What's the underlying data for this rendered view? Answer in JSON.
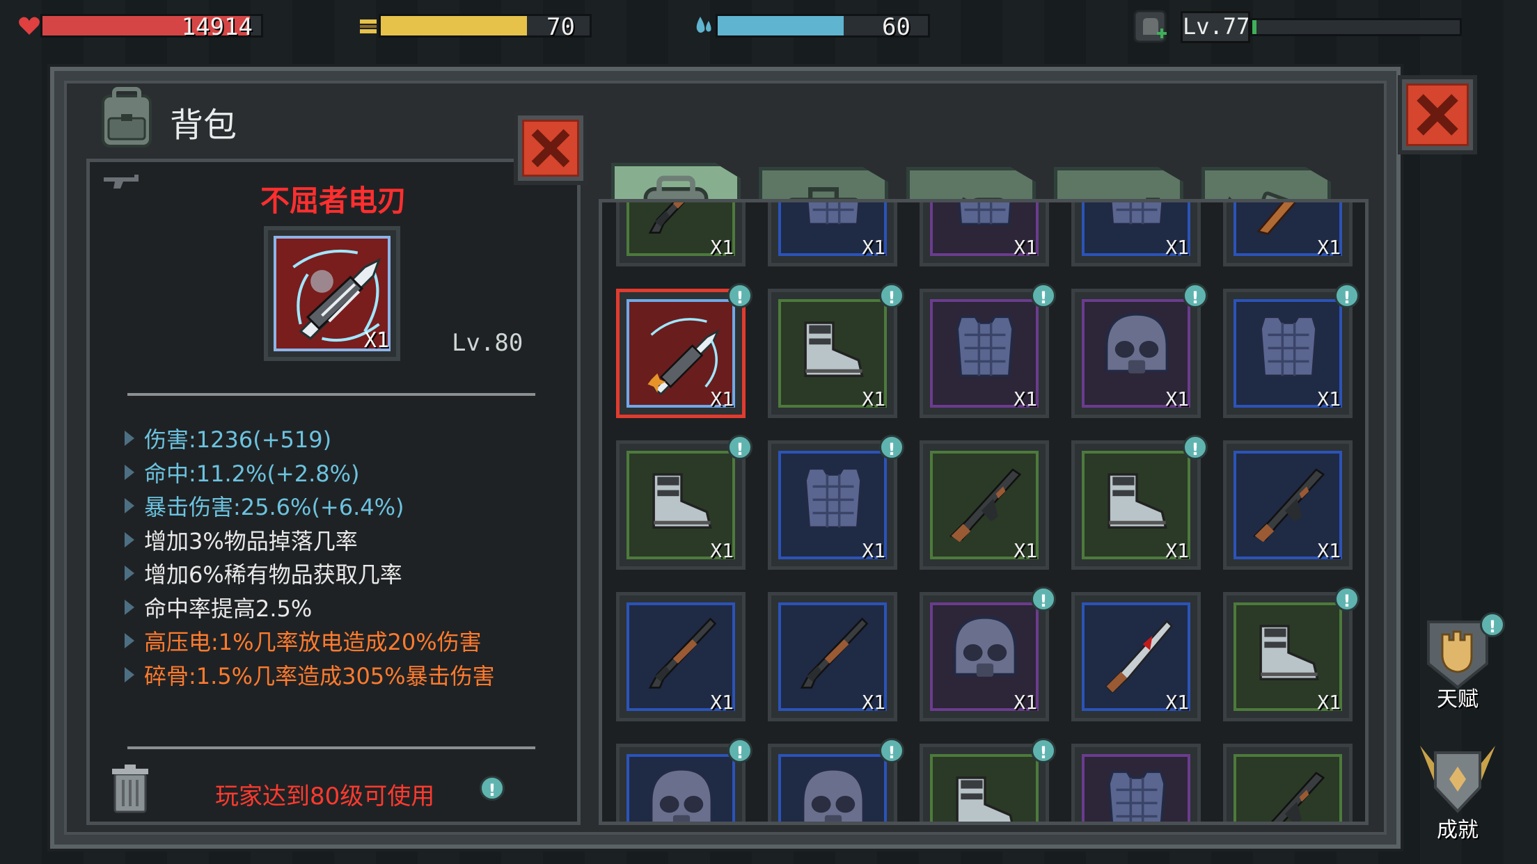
{
  "hud": {
    "hp": {
      "value": "14914",
      "fill": 0.95,
      "color": "#d64545"
    },
    "food": {
      "value": "70",
      "fill": 0.7,
      "color": "#e6c24a"
    },
    "water": {
      "value": "60",
      "fill": 0.6,
      "color": "#5fb4cf"
    },
    "level": {
      "label": "Lv.77",
      "fill": 0.02,
      "color": "#3fb05a"
    }
  },
  "panel": {
    "title": "背包",
    "item": {
      "name": "不屈者电刃",
      "qty": "X1",
      "level": "Lv.80",
      "stats": [
        {
          "text": "伤害:1236(+519)",
          "color": "blue"
        },
        {
          "text": "命中:11.2%(+2.8%)",
          "color": "blue"
        },
        {
          "text": "暴击伤害:25.6%(+6.4%)",
          "color": "blue"
        },
        {
          "text": "增加3%物品掉落几率",
          "color": "white"
        },
        {
          "text": "增加6%稀有物品获取几率",
          "color": "white"
        },
        {
          "text": "命中率提高2.5%",
          "color": "white"
        },
        {
          "text": "高压电:1%几率放电造成20%伤害",
          "color": "orange"
        },
        {
          "text": "碎骨:1.5%几率造成305%暴击伤害",
          "color": "orange"
        }
      ],
      "requirement": "玩家达到80级可使用",
      "info_badge": "!"
    },
    "tabs": [
      {
        "name": "backpack-tab-icon",
        "active": true
      },
      {
        "name": "medkit-tab-icon",
        "active": false
      },
      {
        "name": "food-tab-icon",
        "active": false
      },
      {
        "name": "gun-tab-icon",
        "active": false
      },
      {
        "name": "tools-tab-icon",
        "active": false
      }
    ],
    "grid": [
      [
        {
          "icon": "shotgun",
          "rarity": "green",
          "qty": "X1",
          "badge": false
        },
        {
          "icon": "armor",
          "rarity": "blue",
          "qty": "X1",
          "badge": false
        },
        {
          "icon": "armor",
          "rarity": "purple",
          "qty": "X1",
          "badge": false
        },
        {
          "icon": "armor",
          "rarity": "blue",
          "qty": "X1",
          "badge": false
        },
        {
          "icon": "bat",
          "rarity": "blue",
          "qty": "X1",
          "badge": false
        }
      ],
      [
        {
          "icon": "blade",
          "rarity": "red",
          "qty": "X1",
          "badge": true,
          "selected": true
        },
        {
          "icon": "boots",
          "rarity": "green",
          "qty": "X1",
          "badge": true
        },
        {
          "icon": "armor",
          "rarity": "purple",
          "qty": "X1",
          "badge": true
        },
        {
          "icon": "helmet",
          "rarity": "purple",
          "qty": "X1",
          "badge": true
        },
        {
          "icon": "armor",
          "rarity": "blue",
          "qty": "X1",
          "badge": true
        }
      ],
      [
        {
          "icon": "boots",
          "rarity": "green",
          "qty": "X1",
          "badge": true
        },
        {
          "icon": "armor",
          "rarity": "blue",
          "qty": "X1",
          "badge": true
        },
        {
          "icon": "rifle",
          "rarity": "green",
          "qty": "X1",
          "badge": false
        },
        {
          "icon": "boots",
          "rarity": "green",
          "qty": "X1",
          "badge": true
        },
        {
          "icon": "rifle",
          "rarity": "blue",
          "qty": "X1",
          "badge": false
        }
      ],
      [
        {
          "icon": "shotgun",
          "rarity": "blue",
          "qty": "X1",
          "badge": false
        },
        {
          "icon": "shotgun",
          "rarity": "blue",
          "qty": "X1",
          "badge": false
        },
        {
          "icon": "helmet",
          "rarity": "purple",
          "qty": "X1",
          "badge": true
        },
        {
          "icon": "knife",
          "rarity": "blue",
          "qty": "X1",
          "badge": false
        },
        {
          "icon": "boots",
          "rarity": "green",
          "qty": "X1",
          "badge": true
        }
      ],
      [
        {
          "icon": "helmet",
          "rarity": "blue",
          "qty": "",
          "badge": true
        },
        {
          "icon": "helmet",
          "rarity": "blue",
          "qty": "",
          "badge": true
        },
        {
          "icon": "boots",
          "rarity": "green",
          "qty": "",
          "badge": true
        },
        {
          "icon": "armor",
          "rarity": "purple",
          "qty": "",
          "badge": false
        },
        {
          "icon": "rifle",
          "rarity": "green",
          "qty": "",
          "badge": false
        }
      ]
    ]
  },
  "side": {
    "talent": "天赋",
    "achievement": "成就",
    "badge": "!"
  }
}
